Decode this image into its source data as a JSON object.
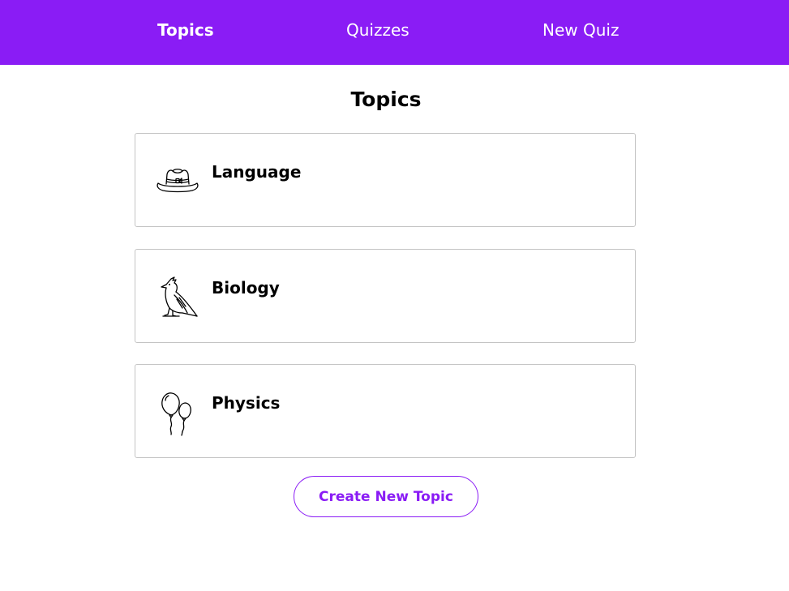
{
  "nav": {
    "items": [
      {
        "label": "Topics",
        "active": true
      },
      {
        "label": "Quizzes",
        "active": false
      },
      {
        "label": "New Quiz",
        "active": false
      }
    ],
    "color": "#8a1cf5"
  },
  "page": {
    "title": "Topics"
  },
  "topics": [
    {
      "name": "Language",
      "icon": "hat-icon"
    },
    {
      "name": "Biology",
      "icon": "bird-icon"
    },
    {
      "name": "Physics",
      "icon": "balloons-icon"
    }
  ],
  "actions": {
    "create_label": "Create New Topic"
  }
}
